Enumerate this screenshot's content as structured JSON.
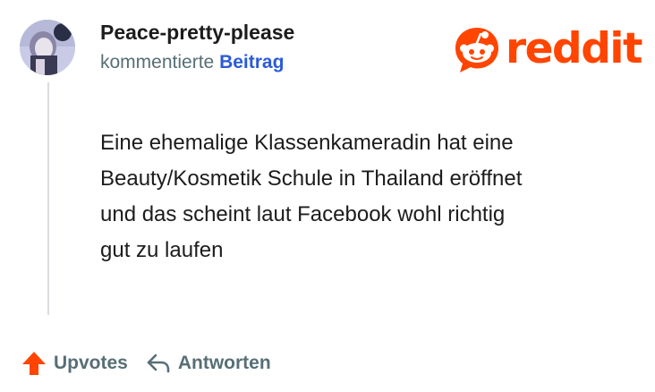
{
  "header": {
    "username": "Peace-pretty-please",
    "action_text": "kommentierte",
    "target_link": "Beitrag"
  },
  "brand": {
    "name": "reddit",
    "color": "#ff4500"
  },
  "comment": {
    "lines": [
      "Eine ehemalige Klassenkameradin hat eine",
      "Beauty/Kosmetik Schule in Thailand eröffnet",
      "und das scheint laut Facebook wohl richtig",
      "gut zu laufen"
    ]
  },
  "actions": {
    "upvote_label": "Upvotes",
    "upvote_icon": "upvote-arrow-icon",
    "upvote_color": "#ff4500",
    "reply_label": "Antworten",
    "reply_icon": "reply-arrow-icon"
  },
  "colors": {
    "meta_gray": "#576f76",
    "link_blue": "#2a5bd7",
    "text": "#1c1c1c"
  }
}
